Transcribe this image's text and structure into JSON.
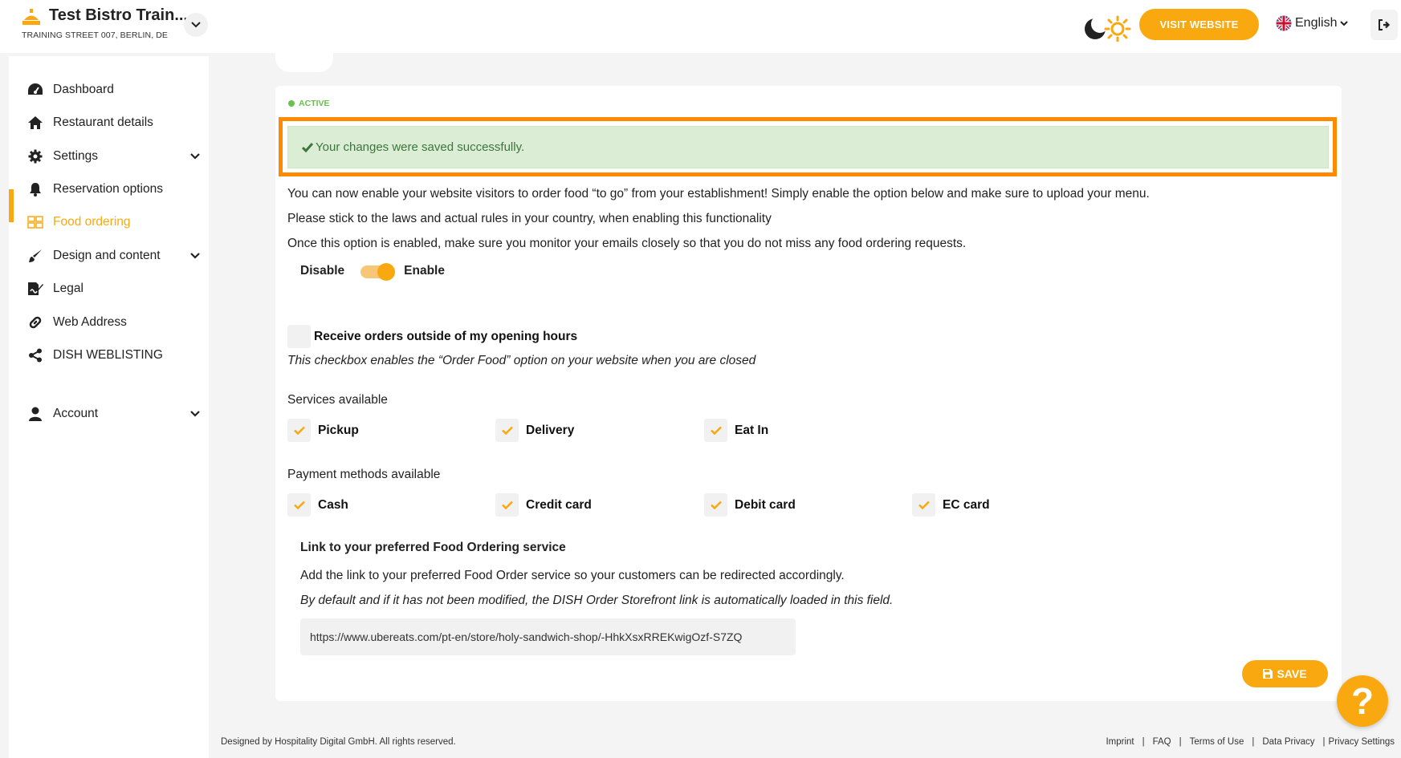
{
  "header": {
    "restaurant_name": "Test Bistro Train...",
    "restaurant_address": "TRAINING STREET 007, BERLIN, DE",
    "visit_website_label": "VISIT WEBSITE",
    "language_label": "English",
    "theme_icon": "moon-sun-icon",
    "logout_icon": "logout-icon"
  },
  "sidebar": {
    "items": [
      {
        "label": "Dashboard",
        "icon": "dashboard-gauge-icon"
      },
      {
        "label": "Restaurant details",
        "icon": "home-icon"
      },
      {
        "label": "Settings",
        "icon": "gear-icon",
        "has_submenu": true
      },
      {
        "label": "Reservation options",
        "icon": "bell-icon"
      },
      {
        "label": "Food ordering",
        "icon": "food-ordering-icon",
        "active": true
      },
      {
        "label": "Design and content",
        "icon": "brush-icon",
        "has_submenu": true
      },
      {
        "label": "Legal",
        "icon": "signature-document-icon"
      },
      {
        "label": "Web Address",
        "icon": "link-icon"
      },
      {
        "label": "DISH WEBLISTING",
        "icon": "share-icon"
      },
      {
        "label": "Account",
        "icon": "user-icon",
        "has_submenu": true
      }
    ],
    "accent_color": "#f9a90f"
  },
  "main": {
    "status_label": "ACTIVE",
    "success_message": "Your changes were saved successfully.",
    "intro_lines": [
      "You can now enable your website visitors to order food “to go” from your establishment! Simply enable the option below and make sure to upload your menu.",
      "Please stick to the laws and actual rules in your country, when enabling this functionality",
      "Once this option is enabled, make sure you monitor your emails closely so that you do not miss any food ordering requests."
    ],
    "toggle": {
      "off_label": "Disable",
      "on_label": "Enable",
      "enabled": true
    },
    "outside_hours": {
      "label": "Receive orders outside of my opening hours",
      "description": "This checkbox enables the “Order Food” option on your website when you are closed",
      "checked": false
    },
    "services": {
      "title": "Services available",
      "options": [
        {
          "label": "Pickup",
          "checked": true
        },
        {
          "label": "Delivery",
          "checked": true
        },
        {
          "label": "Eat In",
          "checked": true
        }
      ]
    },
    "payments": {
      "title": "Payment methods available",
      "options": [
        {
          "label": "Cash",
          "checked": true
        },
        {
          "label": "Credit card",
          "checked": true
        },
        {
          "label": "Debit card",
          "checked": true
        },
        {
          "label": "EC card",
          "checked": true
        }
      ]
    },
    "link_section": {
      "title": "Link to your preferred Food Ordering service",
      "description": "Add the link to your preferred Food Order service so your customers can be redirected accordingly.",
      "note": "By default and if it has not been modified, the DISH Order Storefront link is automatically loaded in this field.",
      "url_value": "https://www.ubereats.com/pt-en/store/holy-sandwich-shop/-HhkXsxRREKwigOzf-S7ZQ"
    },
    "save_label": "SAVE",
    "help_label": "?"
  },
  "footer": {
    "copyright": "Designed by Hospitality Digital GmbH. All rights reserved.",
    "links": [
      "Imprint",
      "FAQ",
      "Terms of Use",
      "Data Privacy",
      "Privacy Settings"
    ]
  },
  "colors": {
    "accent": "#f9a90f",
    "success_bg": "#dcedd5",
    "success_text": "#3b763d",
    "highlight_outline": "#ff8a00",
    "status_green": "#6bc04b"
  }
}
